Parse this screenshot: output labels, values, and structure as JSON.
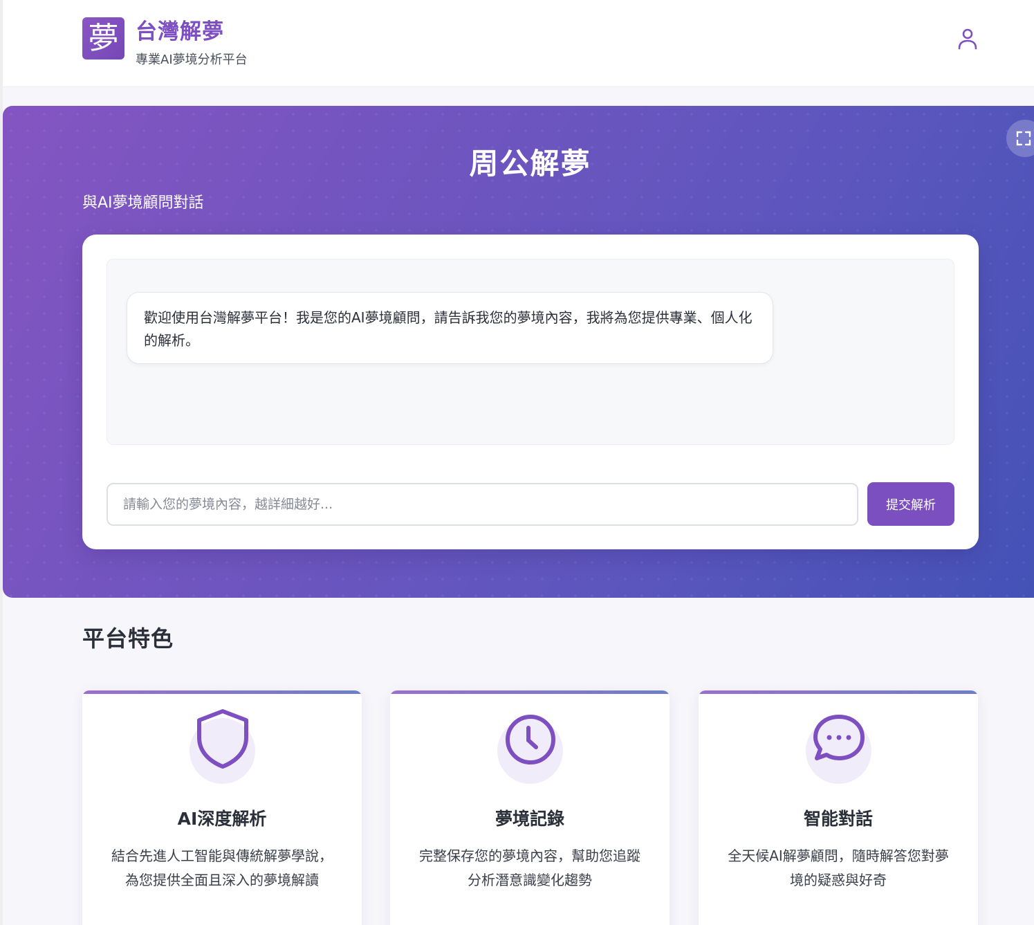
{
  "header": {
    "logo_glyph": "夢",
    "title": "台灣解夢",
    "subtitle": "專業AI夢境分析平台",
    "user_icon": "user-icon"
  },
  "hero": {
    "title": "周公解夢",
    "subtitle": "與AI夢境顧問對話",
    "expand_icon": "expand-icon"
  },
  "chat": {
    "welcome_message": "歡迎使用台灣解夢平台！我是您的AI夢境顧問，請告訴我您的夢境內容，我將為您提供專業、個人化的解析。",
    "input_placeholder": "請輸入您的夢境內容，越詳細越好...",
    "input_value": "",
    "submit_label": "提交解析"
  },
  "features": {
    "title": "平台特色",
    "items": [
      {
        "icon": "shield-icon",
        "name": "AI深度解析",
        "desc": "結合先進人工智能與傳統解夢學說，為您提供全面且深入的夢境解讀"
      },
      {
        "icon": "clock-icon",
        "name": "夢境記錄",
        "desc": "完整保存您的夢境內容，幫助您追蹤分析潛意識變化趨勢"
      },
      {
        "icon": "chat-bubble-icon",
        "name": "智能對話",
        "desc": "全天候AI解夢顧問，隨時解答您對夢境的疑惑與好奇"
      }
    ]
  },
  "colors": {
    "brand": "#7d4fc0",
    "hero_start": "#8455c2",
    "hero_end": "#4452b6",
    "button": "#7c4fc0"
  }
}
